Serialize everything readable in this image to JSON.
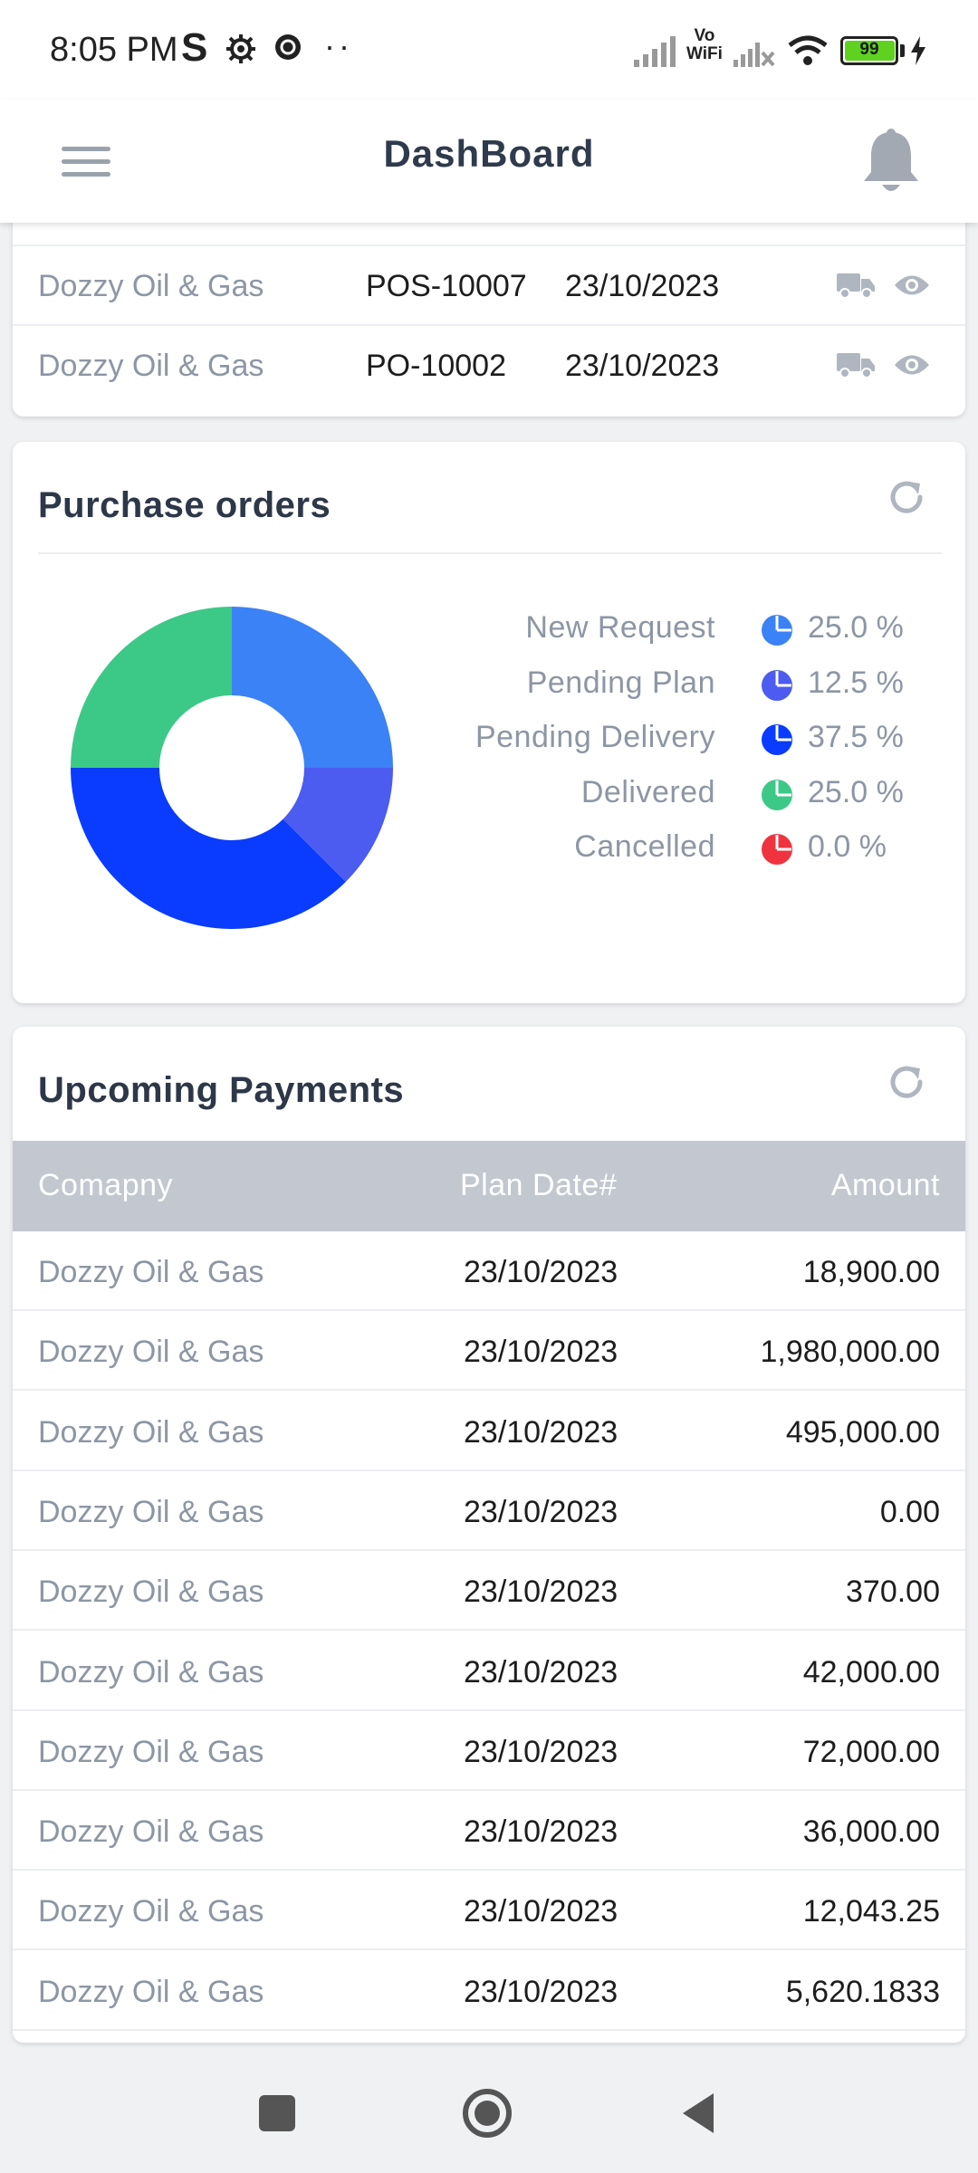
{
  "status_bar": {
    "time": "8:05 PM",
    "s_label": "S",
    "dots": "··",
    "signal_label_top": "Vo",
    "signal_label_bottom": "WiFi",
    "battery_level": "99",
    "battery_fraction": 0.99,
    "battery_color": "#5fd21f"
  },
  "header": {
    "title": "DashBoard",
    "menu_icon": "hamburger-menu-icon",
    "notification_icon": "bell-icon"
  },
  "recent_orders": {
    "rows": [
      {
        "company": "Dozzy Oil & Gas",
        "po": "POS-10007",
        "date": "23/10/2023"
      },
      {
        "company": "Dozzy Oil & Gas",
        "po": "PO-10002",
        "date": "23/10/2023"
      }
    ],
    "row_icons": [
      "truck-icon",
      "eye-icon"
    ]
  },
  "purchase_orders": {
    "title": "Purchase orders",
    "legend": [
      {
        "label": "New Request",
        "percent": "25.0 %",
        "color": "#3b82f6"
      },
      {
        "label": "Pending Plan",
        "percent": "12.5 %",
        "color": "#4c5bf0"
      },
      {
        "label": "Pending Delivery",
        "percent": "37.5 %",
        "color": "#0a3cff"
      },
      {
        "label": "Delivered",
        "percent": "25.0 %",
        "color": "#3cc987"
      },
      {
        "label": "Cancelled",
        "percent": "0.0 %",
        "color": "#f0343f"
      }
    ]
  },
  "chart_data": {
    "type": "pie",
    "categories": [
      "New Request",
      "Pending Plan",
      "Pending Delivery",
      "Delivered",
      "Cancelled"
    ],
    "values": [
      25.0,
      12.5,
      37.5,
      25.0,
      0.0
    ],
    "colors": [
      "#3b82f6",
      "#4c5bf0",
      "#0a3cff",
      "#3cc987",
      "#f0343f"
    ],
    "donut": true,
    "legend_position": "right"
  },
  "upcoming_payments": {
    "title": "Upcoming Payments",
    "columns": {
      "company": "Comapny",
      "plan_date": "Plan Date#",
      "amount": "Amount"
    },
    "rows": [
      {
        "company": "Dozzy Oil & Gas",
        "date": "23/10/2023",
        "amount": "18,900.00"
      },
      {
        "company": "Dozzy Oil & Gas",
        "date": "23/10/2023",
        "amount": "1,980,000.00"
      },
      {
        "company": "Dozzy Oil & Gas",
        "date": "23/10/2023",
        "amount": "495,000.00"
      },
      {
        "company": "Dozzy Oil & Gas",
        "date": "23/10/2023",
        "amount": "0.00"
      },
      {
        "company": "Dozzy Oil & Gas",
        "date": "23/10/2023",
        "amount": "370.00"
      },
      {
        "company": "Dozzy Oil & Gas",
        "date": "23/10/2023",
        "amount": "42,000.00"
      },
      {
        "company": "Dozzy Oil & Gas",
        "date": "23/10/2023",
        "amount": "72,000.00"
      },
      {
        "company": "Dozzy Oil & Gas",
        "date": "23/10/2023",
        "amount": "36,000.00"
      },
      {
        "company": "Dozzy Oil & Gas",
        "date": "23/10/2023",
        "amount": "12,043.25"
      },
      {
        "company": "Dozzy Oil & Gas",
        "date": "23/10/2023",
        "amount": "5,620.1833"
      }
    ]
  },
  "nav_bar": {
    "icons": [
      "recents-square-icon",
      "home-circle-icon",
      "back-triangle-icon"
    ]
  }
}
